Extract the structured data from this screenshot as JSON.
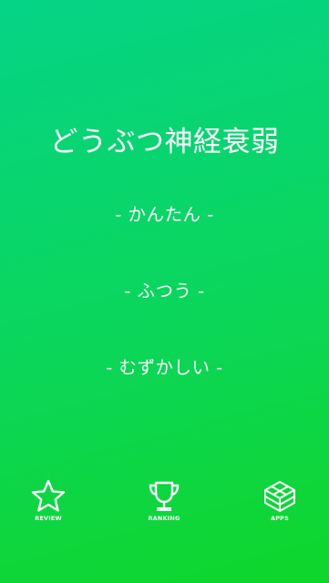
{
  "app": {
    "title": "どうぶつ神経衰弱"
  },
  "menu": {
    "easy_label": "- かんたん -",
    "normal_label": "- ふつう -",
    "hard_label": "- むずかしい -"
  },
  "tabbar": {
    "review_label": "REVIEW",
    "ranking_label": "RANKING",
    "apps_label": "APPS",
    "review_icon": "star-icon",
    "ranking_icon": "trophy-icon",
    "apps_icon": "boxes-icon"
  },
  "colors": {
    "background_top": "#05d487",
    "background_bottom": "#0fd62a",
    "text": "#ffffff"
  }
}
